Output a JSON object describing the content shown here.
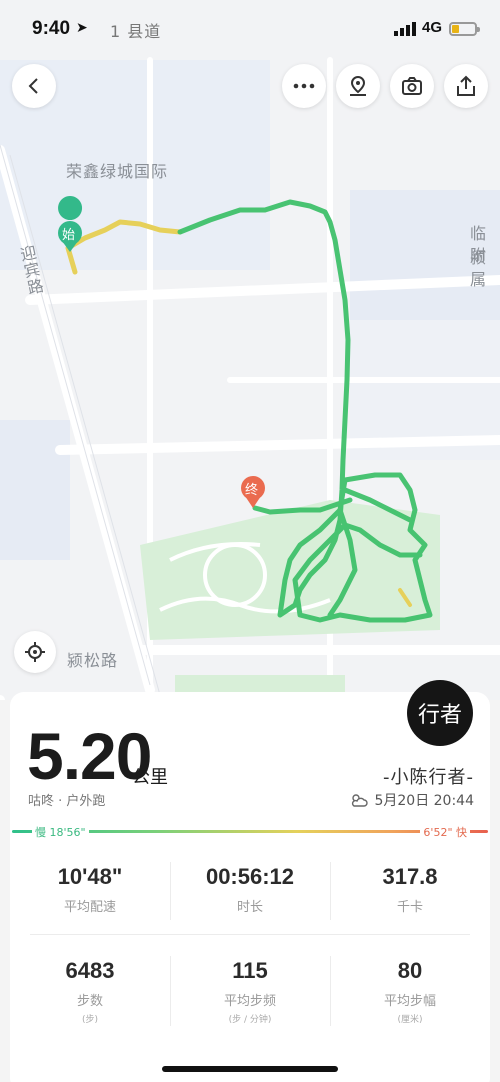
{
  "status_bar": {
    "time": "9:40",
    "network": "4G"
  },
  "map": {
    "labels": {
      "area_a": "荣鑫绿城国际",
      "road_a": "迎宾路",
      "road_b": "颍松路",
      "county_road": "1 县道",
      "edge_a": "临颍",
      "edge_b": "附属"
    },
    "start_marker": "始",
    "end_marker": "终",
    "colors": {
      "park": "#d8efd8",
      "route_start": "#e6d05a",
      "route_main": "#3fc06a"
    }
  },
  "toolbar": {
    "icons": [
      "back-icon",
      "more-icon",
      "pin-icon",
      "camera-icon",
      "share-icon"
    ]
  },
  "summary": {
    "brand": "行者",
    "distance": "5.20",
    "distance_unit": "公里",
    "activity": "咕咚 · 户外跑",
    "user": "-小陈行者-",
    "weather_icon": "partly-cloudy-icon",
    "datetime": "5月20日 20:44",
    "pace_slow": "慢 18'56\"",
    "pace_fast": "6'52\" 快"
  },
  "stats": [
    {
      "value": "10'48\"",
      "label": "平均配速",
      "sub": ""
    },
    {
      "value": "00:56:12",
      "label": "时长",
      "sub": ""
    },
    {
      "value": "317.8",
      "label": "千卡",
      "sub": ""
    },
    {
      "value": "6483",
      "label": "步数",
      "sub": "(步)"
    },
    {
      "value": "115",
      "label": "平均步频",
      "sub": "(步 / 分钟)"
    },
    {
      "value": "80",
      "label": "平均步幅",
      "sub": "(厘米)"
    }
  ]
}
